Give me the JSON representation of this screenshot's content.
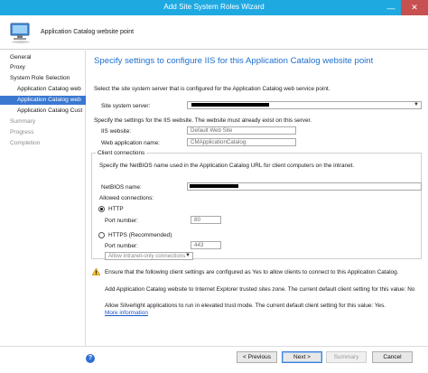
{
  "window": {
    "title": "Add Site System Roles Wizard",
    "minimize": "—",
    "close": "✕"
  },
  "header": {
    "title": "Application Catalog website point",
    "icon": "server-computer-icon"
  },
  "sidebar": {
    "items": [
      {
        "label": "General",
        "state": "normal",
        "level": 0
      },
      {
        "label": "Proxy",
        "state": "normal",
        "level": 0
      },
      {
        "label": "System Role Selection",
        "state": "normal",
        "level": 0
      },
      {
        "label": "Application Catalog web",
        "state": "normal",
        "level": 1
      },
      {
        "label": "Application Catalog web",
        "state": "active",
        "level": 1
      },
      {
        "label": "Application Catalog Cust",
        "state": "normal",
        "level": 1
      },
      {
        "label": "Summary",
        "state": "disabled",
        "level": 0
      },
      {
        "label": "Progress",
        "state": "disabled",
        "level": 0
      },
      {
        "label": "Completion",
        "state": "disabled",
        "level": 0
      }
    ]
  },
  "main": {
    "title": "Specify settings to configure IIS for this Application Catalog website point",
    "select_server_text": "Select the site system server that is configured for the Application Catalog web service point.",
    "site_system_server_label": "Site system server:",
    "iis_intro": "Specify the settings for the IIS website. The website must already exist on this server.",
    "iis_website_label": "IIS website:",
    "iis_website_value": "Default Web Site",
    "web_app_name_label": "Web application name:",
    "web_app_name_value": "CMApplicationCatalog",
    "client_connections_group": "Client connections",
    "netbios_intro": "Specify the NetBIOS name used in the Application Catalog URL for client computers on the intranet.",
    "netbios_label": "NetBIOS name:",
    "allowed_connections_label": "Allowed connections:",
    "http_label": "HTTP",
    "http_port_label": "Port number:",
    "http_port_value": "80",
    "https_label": "HTTPS (Recommended)",
    "https_port_label": "Port number:",
    "https_port_value": "443",
    "https_dropdown_value": "Allow intranet-only connections",
    "warning_text": "Ensure that the following client settings are configured as Yes to allow clients to connect to this Application Catalog.",
    "ie_trusted_text": "Add Application Catalog website to Internet Explorer trusted sites zone. The current default client setting for this value: No",
    "silverlight_text": "Allow Silverlight applications to run in elevated trust mode. The current default client setting for this value: Yes.",
    "more_info_link": "More information"
  },
  "footer": {
    "help_icon": "help-icon",
    "previous_label": "< Previous",
    "next_label": "Next >",
    "summary_label": "Summary",
    "cancel_label": "Cancel"
  }
}
